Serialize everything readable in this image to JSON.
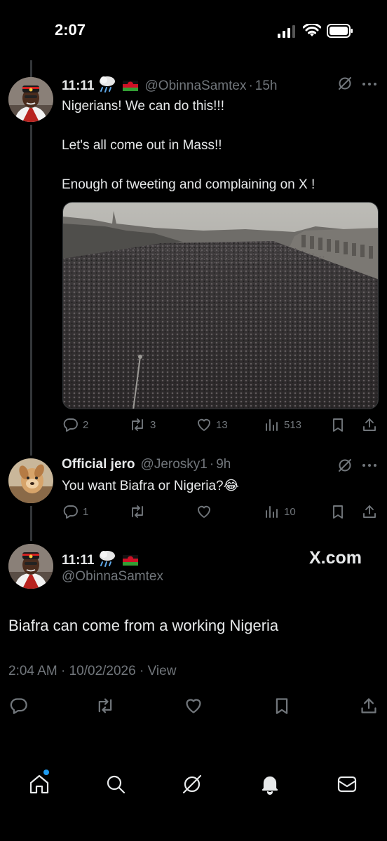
{
  "status_bar": {
    "time": "2:07"
  },
  "tweet1": {
    "display_name": "11:11",
    "handle": "@ObinnaSamtex",
    "time": "15h",
    "lines": [
      "Nigerians! We can do this!!!",
      "Let's all come out in Mass!!",
      "Enough of tweeting and complaining on X !"
    ],
    "actions": {
      "replies": "2",
      "reposts": "3",
      "likes": "13",
      "views": "513"
    }
  },
  "reply": {
    "display_name": "Official jero",
    "handle": "@Jerosky1",
    "time": "9h",
    "text": "You want Biafra or Nigeria?😂",
    "actions": {
      "replies": "1",
      "reposts": "",
      "likes": "",
      "views": "10"
    }
  },
  "main_tweet": {
    "display_name": "11:11",
    "handle": "@ObinnaSamtex",
    "watermark": "X.com",
    "text": "Biafra can come from a working Nigeria",
    "timestamp": "2:04 AM · 10/02/2026 · View"
  },
  "tab_bar": {
    "items": [
      "home",
      "search",
      "grok",
      "notifications",
      "messages"
    ]
  },
  "colors": {
    "background": "#000000",
    "text": "#e7e9ea",
    "muted": "#71767b",
    "accent": "#1d9bf0"
  }
}
